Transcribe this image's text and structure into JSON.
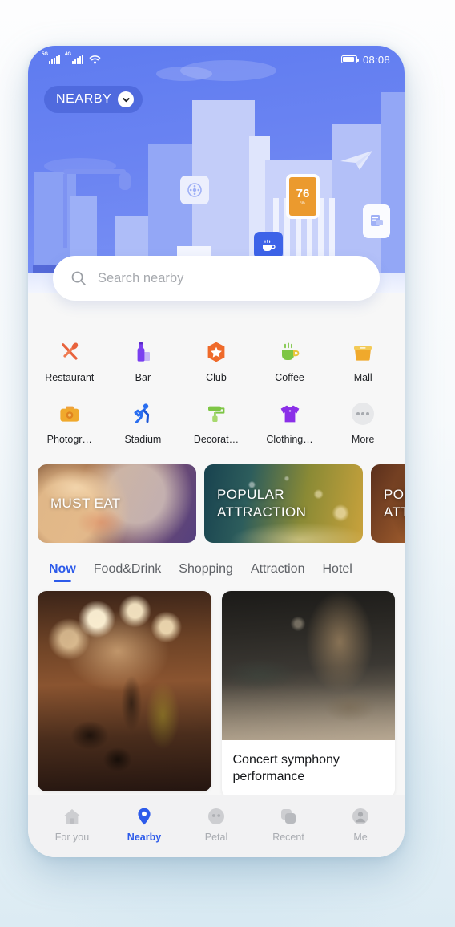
{
  "app": {
    "accent": "#2d5bea",
    "hero_blue": "#6b84f2",
    "surface": "#f7f7f7"
  },
  "status_bar": {
    "net_primary": "5G",
    "net_secondary": "4G",
    "wifi_icon": "wifi-icon",
    "battery_icon": "battery-full-icon",
    "time": "08:08"
  },
  "header": {
    "location_label": "NEARBY",
    "chevron_icon": "chevron-down-icon"
  },
  "hero": {
    "signs": [
      {
        "name": "game-controller-sign",
        "icon": "game-controller-icon"
      },
      {
        "name": "billboard-sign",
        "value": "76",
        "unit": "%"
      },
      {
        "name": "coffee-sign",
        "icon": "coffee-cup-icon"
      },
      {
        "name": "document-sign",
        "icon": "document-icon"
      },
      {
        "name": "paper-plane-sign",
        "icon": "paper-plane-icon"
      }
    ]
  },
  "search": {
    "icon": "search-icon",
    "placeholder": "Search nearby",
    "value": ""
  },
  "categories": {
    "row1": [
      {
        "label": "Restaurant",
        "icon": "cutlery-icon",
        "color": "#e8623c"
      },
      {
        "label": "Bar",
        "icon": "bottle-icon",
        "color": "#7a3ff0"
      },
      {
        "label": "Club",
        "icon": "star-badge-icon",
        "color": "#ef6a2a"
      },
      {
        "label": "Coffee",
        "icon": "coffee-cup-icon",
        "color": "#7ec645"
      },
      {
        "label": "Mall",
        "icon": "shopping-bag-icon",
        "color": "#f0a92c"
      }
    ],
    "row2": [
      {
        "label": "Photogr…",
        "icon": "camera-icon",
        "color": "#f0a13a"
      },
      {
        "label": "Stadium",
        "icon": "runner-icon",
        "color": "#2a6ef0"
      },
      {
        "label": "Decorat…",
        "icon": "paint-roller-icon",
        "color": "#7ec645"
      },
      {
        "label": "Clothing…",
        "icon": "tshirt-icon",
        "color": "#8b2fe8"
      },
      {
        "label": "More",
        "icon": "more-dots-icon",
        "color": "#a8abb0"
      }
    ]
  },
  "banners": [
    {
      "title": "MUST EAT",
      "name": "banner-must-eat"
    },
    {
      "title": "POPULAR ATTRACTION",
      "name": "banner-popular-attraction"
    },
    {
      "title": "POPULAR ATTRACTION",
      "name": "banner-popular-attraction-2"
    }
  ],
  "tabs": [
    {
      "label": "Now",
      "active": true
    },
    {
      "label": "Food&Drink",
      "active": false
    },
    {
      "label": "Shopping",
      "active": false
    },
    {
      "label": "Attraction",
      "active": false
    },
    {
      "label": "Hotel",
      "active": false
    }
  ],
  "feed": {
    "left": {
      "image_alt": "live-band-concert-photo",
      "caption": ""
    },
    "right": {
      "image_alt": "restaurant-interior-photo",
      "caption": "Concert symphony performance"
    }
  },
  "bottom_nav": [
    {
      "label": "For you",
      "icon": "home-icon",
      "active": false
    },
    {
      "label": "Nearby",
      "icon": "location-pin-icon",
      "active": true
    },
    {
      "label": "Petal",
      "icon": "petal-face-icon",
      "active": false
    },
    {
      "label": "Recent",
      "icon": "stacked-cards-icon",
      "active": false
    },
    {
      "label": "Me",
      "icon": "person-icon",
      "active": false
    }
  ]
}
